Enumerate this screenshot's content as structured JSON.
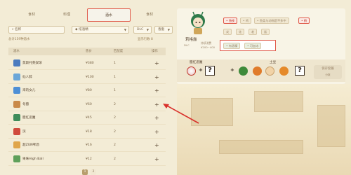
{
  "tabs": [
    {
      "label": "食材"
    },
    {
      "label": "料理"
    },
    {
      "label": "酒水"
    },
    {
      "label": "食材"
    }
  ],
  "filters": {
    "search_placeholder": "名称",
    "tag": "炫酒精",
    "dlc": "DLC",
    "sort": "香脂"
  },
  "summary": {
    "left": "总计159种酒水",
    "right": "显示行数  8"
  },
  "table": {
    "headers": [
      "酒水",
      "售价",
      "匹配度",
      "操作"
    ],
    "rows": [
      {
        "name": "莫斯托莱奴球",
        "price": "¥380",
        "match": "1",
        "op": "+",
        "color": "#4b7bbf"
      },
      {
        "name": "仙人醉",
        "price": "¥100",
        "match": "1",
        "op": "+",
        "color": "#6aa6d8"
      },
      {
        "name": "海的女儿",
        "price": "¥80",
        "match": "1",
        "op": "+",
        "color": "#4d8fd6"
      },
      {
        "name": "冬酿",
        "price": "¥60",
        "match": "2",
        "op": "+",
        "color": "#c98a4a"
      },
      {
        "name": "腊红恶魔",
        "price": "¥45",
        "match": "2",
        "op": "+",
        "color": "#3d8c5a"
      },
      {
        "name": "滨",
        "price": "¥18",
        "match": "2",
        "op": "+",
        "color": "#d04a3c"
      },
      {
        "name": "超ZUN啤酒",
        "price": "¥16",
        "match": "2",
        "op": "+",
        "color": "#e0a64a"
      },
      {
        "name": "果味High Ball",
        "price": "¥12",
        "match": "2",
        "op": "+",
        "color": "#5fa05a"
      }
    ]
  },
  "character": {
    "name": "莉格露",
    "stats_left": "DLC",
    "stats_right_1": "持续消费",
    "stats_right_2": "¥200~400"
  },
  "tags": {
    "row1": [
      "独夜",
      "鸡",
      "鱼类与动物是不多中",
      "鹤"
    ],
    "row2": [
      "炎",
      "化",
      "老",
      "鲨"
    ],
    "selected_row": [
      "有酒精",
      "可加冰"
    ]
  },
  "recipe": {
    "drink_name": "腊红恶魔",
    "main_food": "土豆",
    "save_label": "保存套餐",
    "save_sub": "分数"
  },
  "pagination": {
    "current": "1",
    "next": "2"
  },
  "colors": {
    "accent": "#e05a4a",
    "bg": "#f3ecd6"
  }
}
